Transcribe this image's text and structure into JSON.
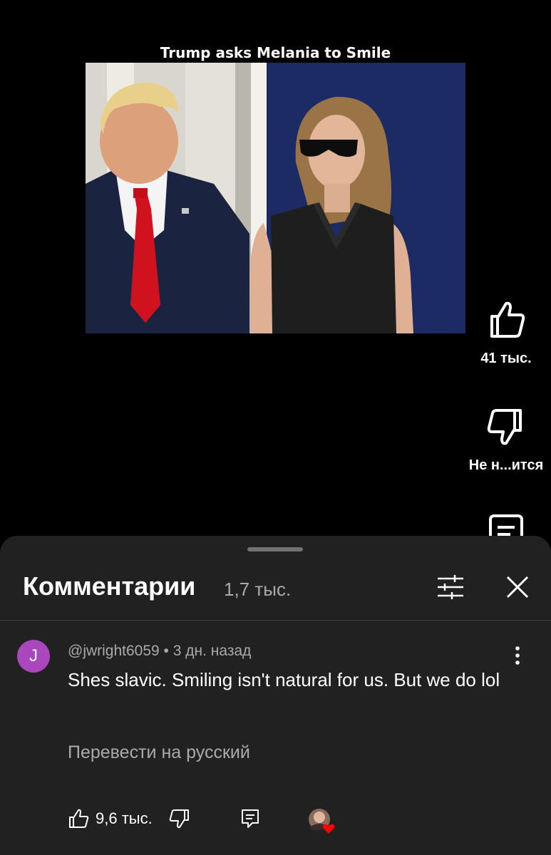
{
  "video": {
    "title": "Trump asks Melania to Smile"
  },
  "actions": {
    "like_count": "41 тыс.",
    "dislike_label": "Не н...ится"
  },
  "comments": {
    "title": "Комментарии",
    "count": "1,7 тыс."
  },
  "comment": {
    "avatar_letter": "J",
    "author": "@jwright6059",
    "separator": " • ",
    "time": "3 дн. назад",
    "text": "Shes slavic.  Smiling isn't natural for us. But we do lol",
    "translate_label": "Перевести на русский",
    "like_count": "9,6 тыс."
  },
  "colors": {
    "background": "#000000",
    "sheet": "#212121",
    "avatar": "#ab47bc",
    "heart": "#ff0000"
  }
}
